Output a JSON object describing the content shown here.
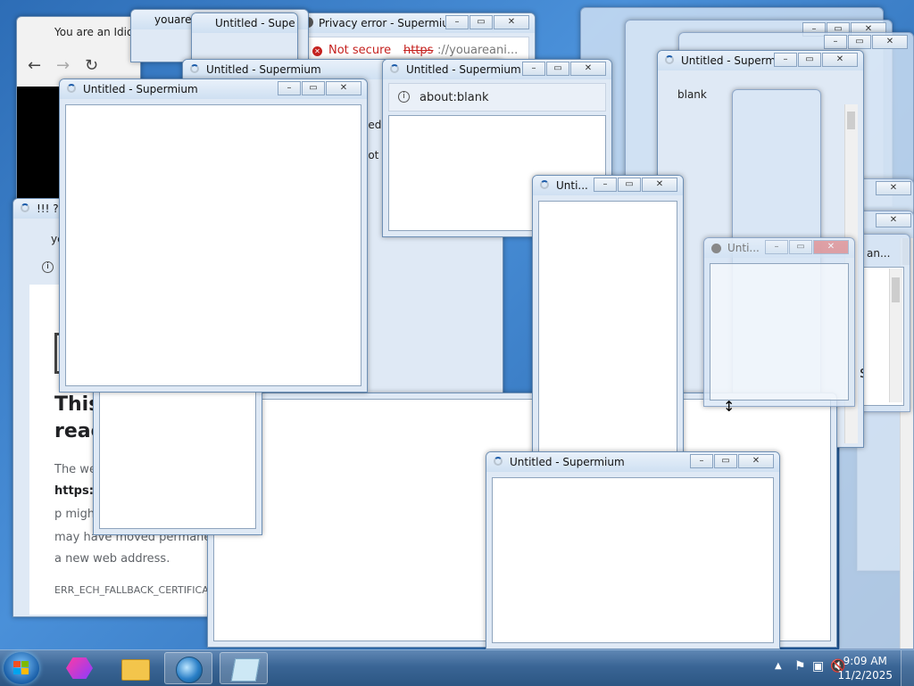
{
  "windows": {
    "idiot_tab": "You are an Idiot",
    "youarea_tab": "youarea",
    "privacy_title": "Privacy error - Supermium",
    "untitled_full": "Untitled - Supermium",
    "untitled_short": "Unti...",
    "untitled_trunc": "Untitled - Supe",
    "untitled_cut": "Untitled - Supe",
    "blank_url": "about:blank",
    "blank_frag": "blank",
    "bang_title": "!!! ?",
    "ye_frag": "ye",
    "an_frag": "an...",
    "s_frag": "s",
    "itled_frag": "itled",
    "oot_frag": "oot"
  },
  "privacy": {
    "not_secure": "Not secure",
    "url_https": "https",
    "url_rest": "://youareani..."
  },
  "errpage": {
    "headline_1": "This",
    "headline_2": "reac",
    "body_1": "The we",
    "body_2": "https:/",
    "body_3": "p migh",
    "body_4": "may have moved permane",
    "body_5": "a new web address.",
    "code": "ERR_ECH_FALLBACK_CERTIFICAT"
  },
  "taskbar": {
    "time": "9:09 AM",
    "date": "11/2/2025",
    "items": [
      "start-orb",
      "hexagon-app-icon",
      "file-explorer-icon",
      "supermium-browser-icon",
      "notepad-icon"
    ]
  },
  "icons": {
    "back": "arrow-left-icon",
    "forward": "arrow-right-icon",
    "reload": "reload-icon",
    "info": "info-icon",
    "error": "error-icon"
  },
  "colors": {
    "error_red": "#c5221f",
    "title_blue": "#1a5aa8"
  }
}
